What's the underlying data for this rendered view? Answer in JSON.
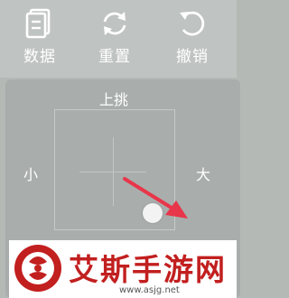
{
  "toolbar": {
    "data_label": "数据",
    "reset_label": "重置",
    "undo_label": "撤销"
  },
  "panel": {
    "top_label": "上挑",
    "left_label": "小",
    "right_label": "大"
  },
  "watermark": {
    "title": "艾斯手游网",
    "url": "www.asjg.net"
  },
  "colors": {
    "accent_arrow": "#e8364a",
    "watermark_red": "#c21f1f"
  }
}
